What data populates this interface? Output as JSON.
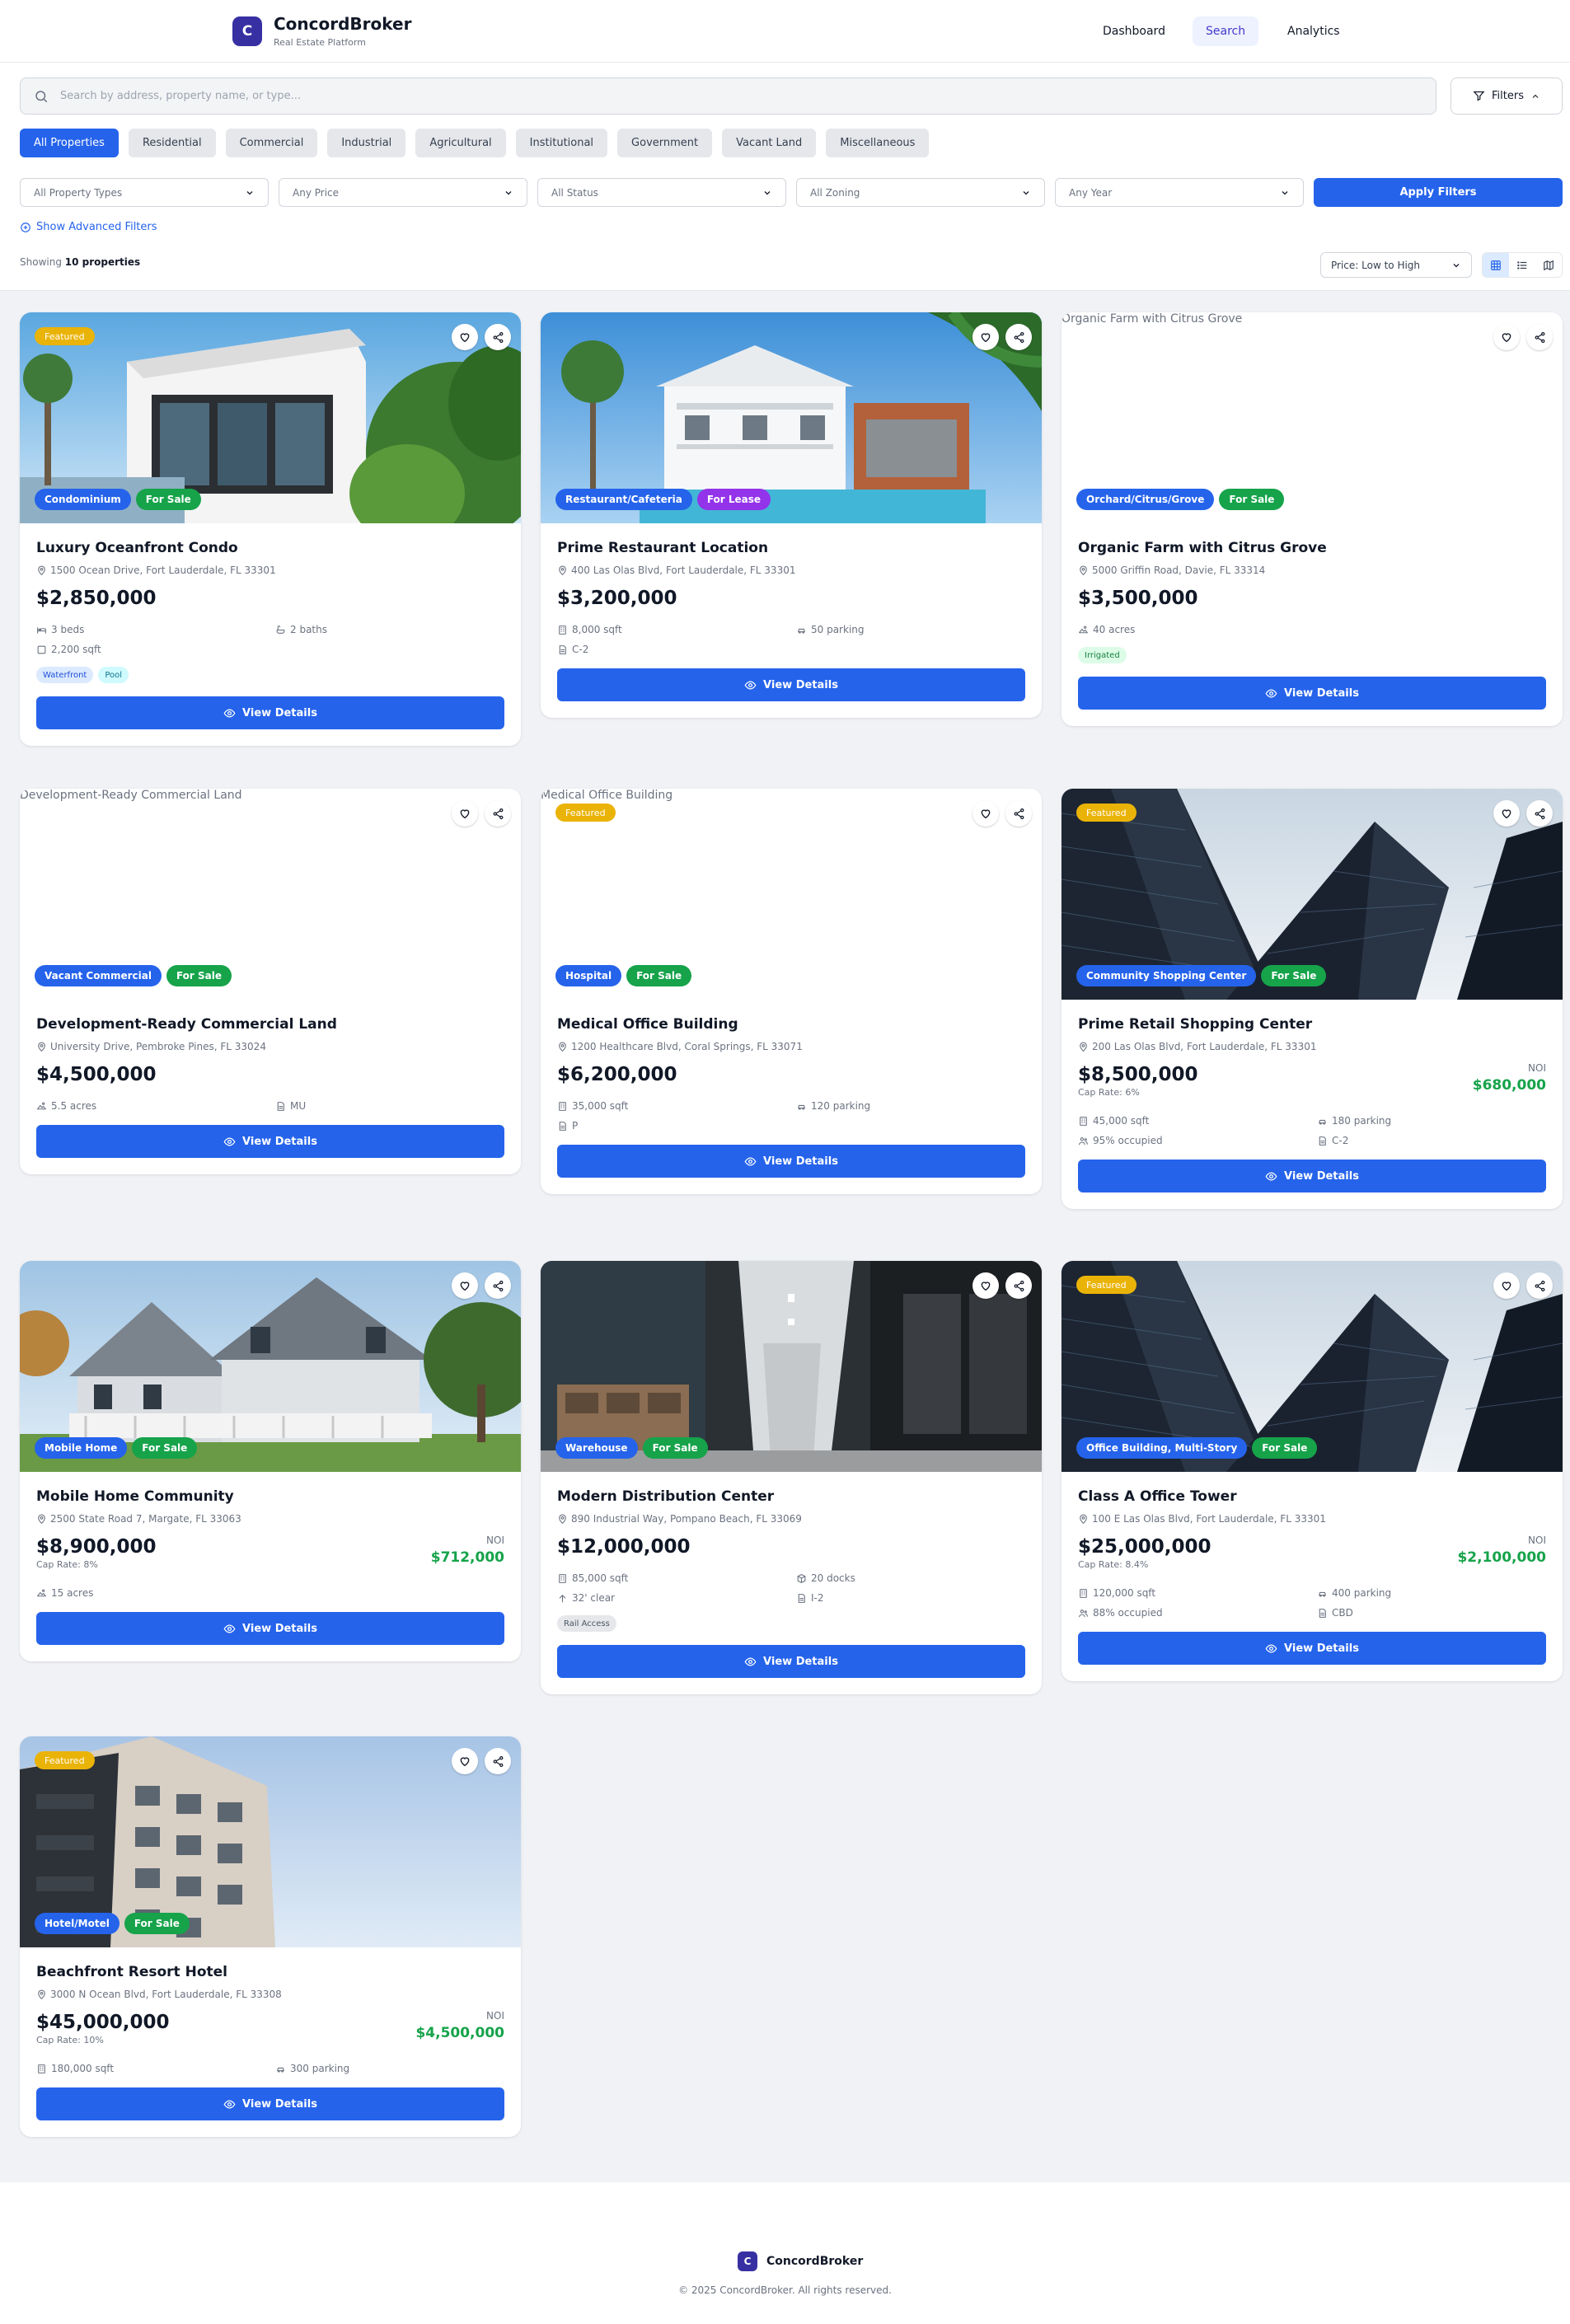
{
  "app": {
    "logo_letter": "C",
    "name": "ConcordBroker",
    "tagline": "Real Estate Platform"
  },
  "nav": {
    "dashboard": "Dashboard",
    "search": "Search",
    "analytics": "Analytics"
  },
  "search": {
    "placeholder": "Search by address, property name, or type...",
    "value": ""
  },
  "filters_button": "Filters",
  "categories": [
    "All Properties",
    "Residential",
    "Commercial",
    "Industrial",
    "Agricultural",
    "Institutional",
    "Government",
    "Vacant Land",
    "Miscellaneous"
  ],
  "active_category": "All Properties",
  "filter_selects": {
    "type": "All Property Types",
    "price": "Any Price",
    "status": "All Status",
    "zoning": "All Zoning",
    "year": "Any Year"
  },
  "apply_button": "Apply Filters",
  "advanced_link": "Show Advanced Filters",
  "results": {
    "prefix": "Showing",
    "count": "10 properties"
  },
  "sort": "Price: Low to High",
  "view_modes": {
    "active": "grid",
    "options": [
      "grid",
      "list",
      "map"
    ]
  },
  "colors": {
    "primary": "#2563eb",
    "brand": "#3730a3",
    "sale": "#16a34a",
    "lease": "#9333ea",
    "featured": "#eab308",
    "noi": "#16a34a"
  },
  "card_common": {
    "featured_label": "Featured",
    "view_label": "View Details",
    "noi_label": "NOI",
    "cap_prefix": "Cap Rate:"
  },
  "properties": [
    {
      "title": "Luxury Oceanfront Condo",
      "address": "1500 Ocean Drive, Fort Lauderdale, FL 33301",
      "price": "$2,850,000",
      "type": "Condominium",
      "status": "For Sale",
      "featured": "Featured",
      "image": "modern-villa-photo",
      "specs": [
        {
          "icon": "bed-icon",
          "text": "3 beds"
        },
        {
          "icon": "bath-icon",
          "text": "2 baths"
        },
        {
          "icon": "square-icon",
          "text": "2,200 sqft"
        }
      ],
      "tags": [
        {
          "text": "Waterfront",
          "color": "blue"
        },
        {
          "text": "Pool",
          "color": "cyan"
        }
      ]
    },
    {
      "title": "Prime Restaurant Location",
      "address": "400 Las Olas Blvd, Fort Lauderdale, FL 33301",
      "price": "$3,200,000",
      "type": "Restaurant/Cafeteria",
      "status": "For Lease",
      "image": "white-house-pool-photo",
      "specs": [
        {
          "icon": "building-icon",
          "text": "8,000 sqft"
        },
        {
          "icon": "car-icon",
          "text": "50 parking"
        },
        {
          "icon": "document-icon",
          "text": "C-2"
        }
      ]
    },
    {
      "title": "Organic Farm with Citrus Grove",
      "address": "5000 Griffin Road, Davie, FL 33314",
      "price": "$3,500,000",
      "type": "Orchard/Citrus/Grove",
      "status": "For Sale",
      "image_alt": "Organic Farm with Citrus Grove",
      "specs": [
        {
          "icon": "land-icon",
          "text": "40 acres"
        }
      ],
      "tags": [
        {
          "text": "Irrigated",
          "color": "green"
        }
      ]
    },
    {
      "title": "Development-Ready Commercial Land",
      "address": "University Drive, Pembroke Pines, FL 33024",
      "price": "$4,500,000",
      "type": "Vacant Commercial",
      "status": "For Sale",
      "image_alt": "Development-Ready Commercial Land",
      "specs": [
        {
          "icon": "land-icon",
          "text": "5.5 acres"
        },
        {
          "icon": "document-icon",
          "text": "MU"
        }
      ]
    },
    {
      "title": "Medical Office Building",
      "address": "1200 Healthcare Blvd, Coral Springs, FL 33071",
      "price": "$6,200,000",
      "type": "Hospital",
      "status": "For Sale",
      "featured": "Featured",
      "image_alt": "Medical Office Building",
      "specs": [
        {
          "icon": "building-icon",
          "text": "35,000 sqft"
        },
        {
          "icon": "car-icon",
          "text": "120 parking"
        },
        {
          "icon": "document-icon",
          "text": "P"
        }
      ]
    },
    {
      "title": "Prime Retail Shopping Center",
      "address": "200 Las Olas Blvd, Fort Lauderdale, FL 33301",
      "price": "$8,500,000",
      "cap": "6%",
      "noi": "$680,000",
      "type": "Community Shopping Center",
      "status": "For Sale",
      "featured": "Featured",
      "image": "skyscrapers-photo",
      "specs": [
        {
          "icon": "building-icon",
          "text": "45,000 sqft"
        },
        {
          "icon": "car-icon",
          "text": "180 parking"
        },
        {
          "icon": "users-icon",
          "text": "95% occupied"
        },
        {
          "icon": "document-icon",
          "text": "C-2"
        }
      ]
    },
    {
      "title": "Mobile Home Community",
      "address": "2500 State Road 7, Margate, FL 33063",
      "price": "$8,900,000",
      "cap": "8%",
      "noi": "$712,000",
      "type": "Mobile Home",
      "status": "For Sale",
      "image": "victorian-house-photo",
      "specs": [
        {
          "icon": "land-icon",
          "text": "15 acres"
        }
      ]
    },
    {
      "title": "Modern Distribution Center",
      "address": "890 Industrial Way, Pompano Beach, FL 33069",
      "price": "$12,000,000",
      "type": "Warehouse",
      "status": "For Sale",
      "image": "office-interior-photo",
      "specs": [
        {
          "icon": "building-icon",
          "text": "85,000 sqft"
        },
        {
          "icon": "package-icon",
          "text": "20 docks"
        },
        {
          "icon": "arrow-up-icon",
          "text": "32' clear"
        },
        {
          "icon": "document-icon",
          "text": "I-2"
        }
      ],
      "tags": [
        {
          "text": "Rail Access",
          "color": "gray"
        }
      ]
    },
    {
      "title": "Class A Office Tower",
      "address": "100 E Las Olas Blvd, Fort Lauderdale, FL 33301",
      "price": "$25,000,000",
      "cap": "8.4%",
      "noi": "$2,100,000",
      "type": "Office Building, Multi-Story",
      "status": "For Sale",
      "featured": "Featured",
      "image": "skyscrapers-photo",
      "specs": [
        {
          "icon": "building-icon",
          "text": "120,000 sqft"
        },
        {
          "icon": "car-icon",
          "text": "400 parking"
        },
        {
          "icon": "users-icon",
          "text": "88% occupied"
        },
        {
          "icon": "document-icon",
          "text": "CBD"
        }
      ]
    },
    {
      "title": "Beachfront Resort Hotel",
      "address": "3000 N Ocean Blvd, Fort Lauderdale, FL 33308",
      "price": "$45,000,000",
      "cap": "10%",
      "noi": "$4,500,000",
      "type": "Hotel/Motel",
      "status": "For Sale",
      "featured": "Featured",
      "image": "apartment-building-photo",
      "specs": [
        {
          "icon": "building-icon",
          "text": "180,000 sqft"
        },
        {
          "icon": "car-icon",
          "text": "300 parking"
        }
      ]
    }
  ],
  "footer": {
    "logo_letter": "C",
    "brand": "ConcordBroker",
    "copyright": "© 2025 ConcordBroker. All rights reserved."
  }
}
